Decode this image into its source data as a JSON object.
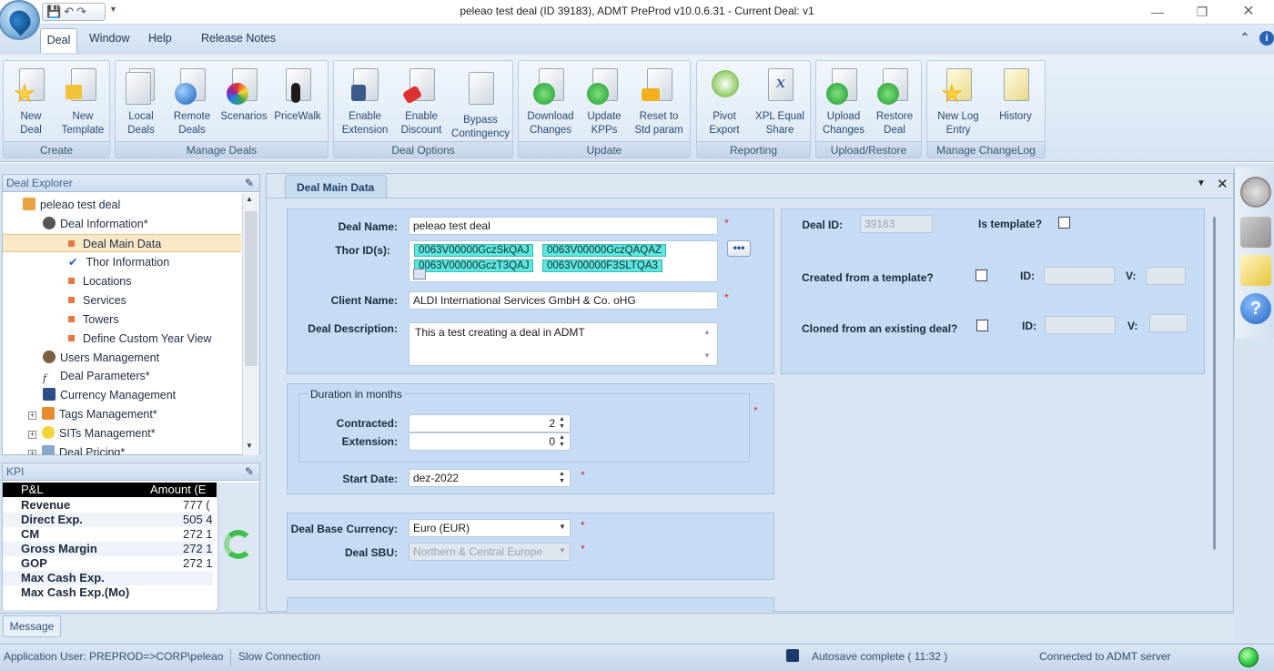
{
  "window": {
    "title": "peleao test deal (ID 39183), ADMT PreProd v10.0.6.31 - Current Deal: v1"
  },
  "menu": {
    "items": [
      "Deal",
      "Window",
      "Help",
      "Release Notes"
    ]
  },
  "ribbon": {
    "groups": [
      {
        "label": "Create",
        "buttons": [
          {
            "l1": "New",
            "l2": "Deal"
          },
          {
            "l1": "New",
            "l2": "Template"
          }
        ]
      },
      {
        "label": "Manage Deals",
        "buttons": [
          {
            "l1": "Local",
            "l2": "Deals"
          },
          {
            "l1": "Remote",
            "l2": "Deals"
          },
          {
            "l1": "Scenarios",
            "l2": ""
          },
          {
            "l1": "PriceWalk",
            "l2": ""
          }
        ]
      },
      {
        "label": "Deal Options",
        "buttons": [
          {
            "l1": "Enable",
            "l2": "Extension"
          },
          {
            "l1": "Enable",
            "l2": "Discount"
          },
          {
            "l1": "Bypass",
            "l2": "Contingency"
          }
        ]
      },
      {
        "label": "Update",
        "buttons": [
          {
            "l1": "Download",
            "l2": "Changes"
          },
          {
            "l1": "Update",
            "l2": "KPPs"
          },
          {
            "l1": "Reset to",
            "l2": "Std param"
          }
        ]
      },
      {
        "label": "Reporting",
        "buttons": [
          {
            "l1": "Pivot",
            "l2": "Export"
          },
          {
            "l1": "XPL Equal",
            "l2": "Share"
          }
        ]
      },
      {
        "label": "Upload/Restore",
        "buttons": [
          {
            "l1": "Upload",
            "l2": "Changes"
          },
          {
            "l1": "Restore",
            "l2": "Deal"
          }
        ]
      },
      {
        "label": "Manage ChangeLog",
        "buttons": [
          {
            "l1": "New Log",
            "l2": "Entry"
          },
          {
            "l1": "History",
            "l2": ""
          }
        ]
      }
    ]
  },
  "explorer": {
    "title": "Deal Explorer",
    "items": [
      "peleao test deal",
      "Deal Information*",
      "Deal Main Data",
      "Thor Information",
      "Locations",
      "Services",
      "Towers",
      "Define Custom Year View",
      "Users Management",
      "Deal Parameters*",
      "Currency Management",
      "Tags Management*",
      "SITs Management*",
      "Deal Pricing*"
    ]
  },
  "kpi": {
    "title": "KPI",
    "col1": "P&L",
    "col2": "Amount (E",
    "rows": [
      {
        "label": "Revenue",
        "value": "777 ("
      },
      {
        "label": "Direct Exp.",
        "value": "505 4"
      },
      {
        "label": "CM",
        "value": "272 1"
      },
      {
        "label": "Gross Margin",
        "value": "272 1"
      },
      {
        "label": "GOP",
        "value": "272 1"
      },
      {
        "label": "Max Cash Exp.",
        "value": ""
      },
      {
        "label": "Max Cash Exp.(Mo)",
        "value": ""
      }
    ]
  },
  "tab": {
    "label": "Deal Main Data"
  },
  "form": {
    "deal_name_label": "Deal Name:",
    "deal_name": "peleao test deal",
    "thor_label": "Thor ID(s):",
    "thor_ids": [
      "0063V00000GczSkQAJ",
      "0063V00000GczQAQAZ",
      "0063V00000GczT3QAJ",
      "0063V00000F3SLTQA3"
    ],
    "client_label": "Client Name:",
    "client_name": "ALDI International Services GmbH & Co. oHG",
    "desc_label": "Deal Description:",
    "description": "This a test creating a deal in ADMT",
    "duration_title": "Duration in months",
    "contracted_label": "Contracted:",
    "contracted": "2",
    "extension_label": "Extension:",
    "extension": "0",
    "start_label": "Start Date:",
    "start_date": "dez-2022",
    "currency_label": "Deal Base Currency:",
    "currency": "Euro (EUR)",
    "sbu_label": "Deal SBU:",
    "sbu": "Northern & Central Europe",
    "deal_id_label": "Deal ID:",
    "deal_id": "39183",
    "is_template_label": "Is template?",
    "created_label": "Created from a template?",
    "cloned_label": "Cloned from an existing deal?",
    "id_label": "ID:",
    "v_label": "V:",
    "required": "*"
  },
  "message_tab": "Message",
  "status": {
    "user": "Application User: PREPROD=>CORP\\peleao",
    "connection": "Slow Connection",
    "autosave": "Autosave complete ( 11:32 )",
    "server": "Connected to ADMT server"
  },
  "colors": {
    "ribbon_bg": "#d6e4f3",
    "form_bg": "#c6dcf5",
    "chip": "#5ce6df",
    "status_ok": "#2ecc40",
    "accent_orange": "#e8773f"
  }
}
